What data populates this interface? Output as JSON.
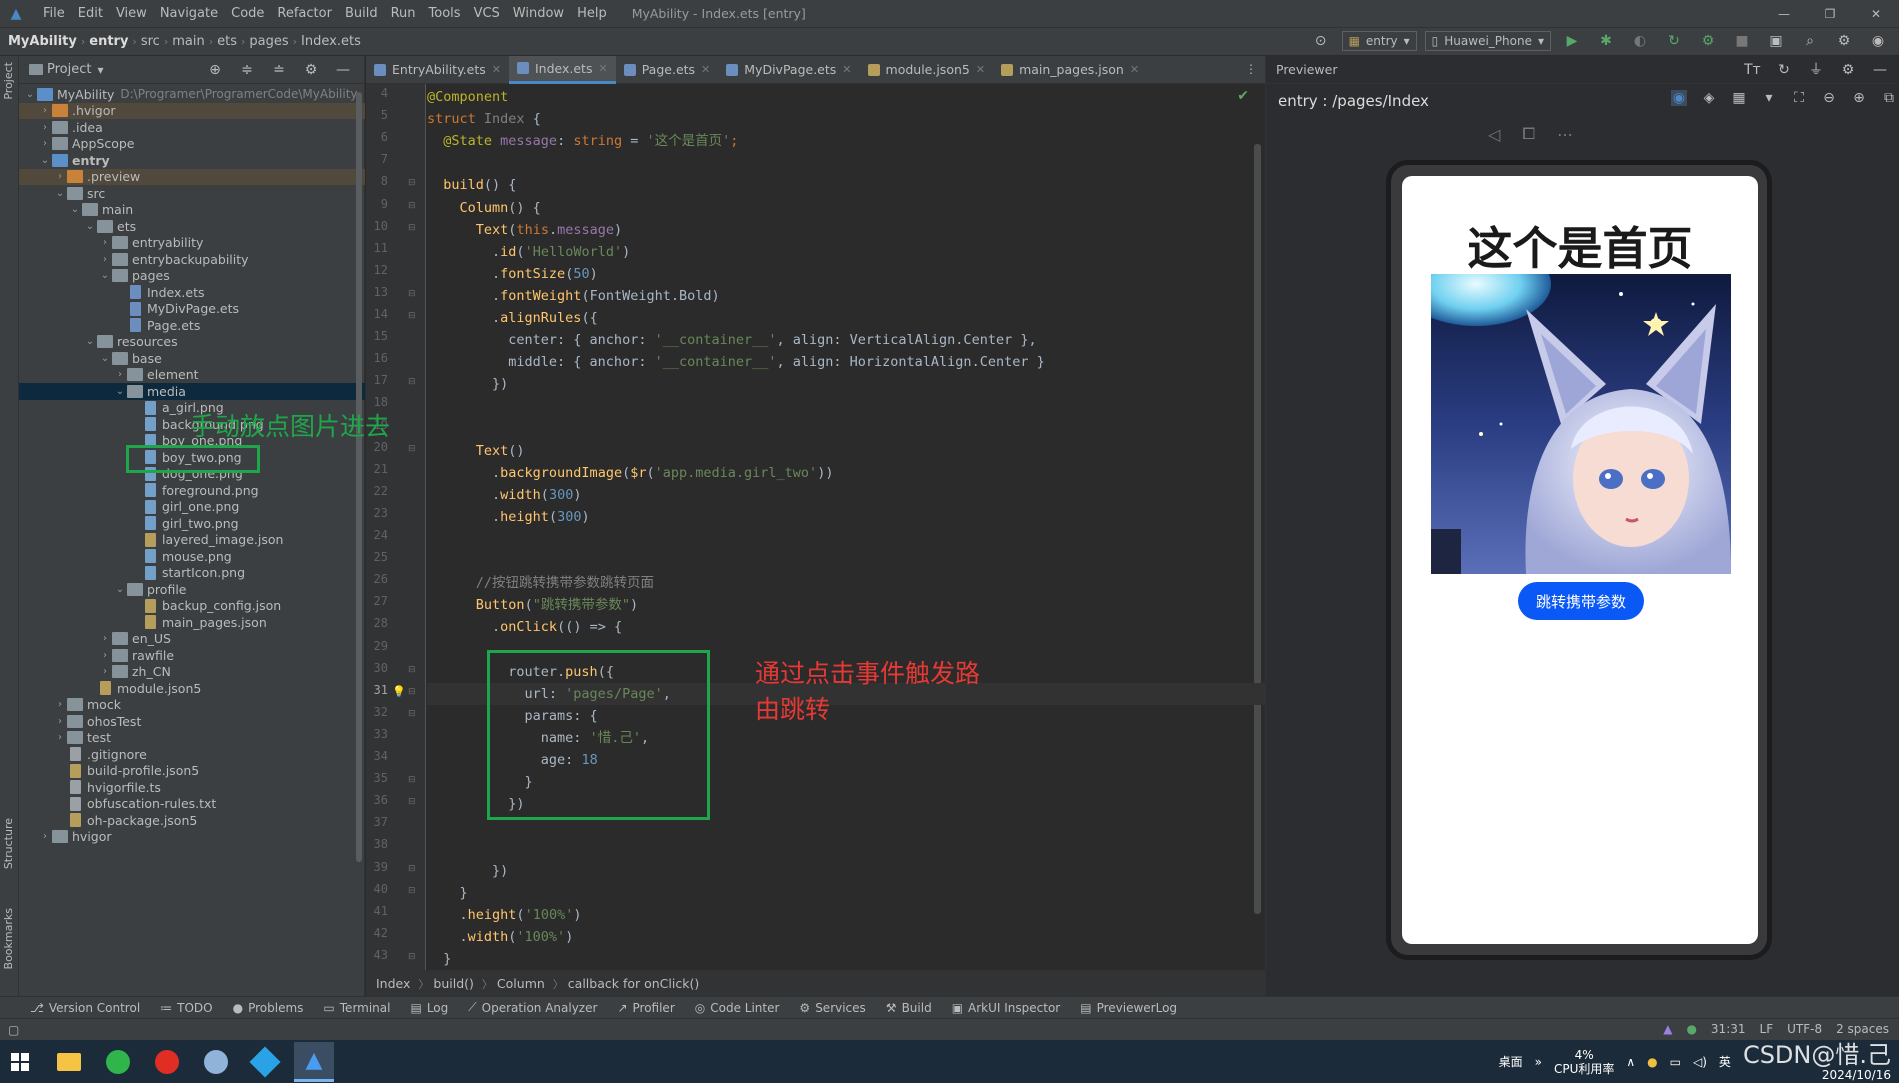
{
  "titlebar": {
    "menu": [
      "File",
      "Edit",
      "View",
      "Navigate",
      "Code",
      "Refactor",
      "Build",
      "Run",
      "Tools",
      "VCS",
      "Window",
      "Help"
    ],
    "title": "MyAbility - Index.ets [entry]"
  },
  "navbar": {
    "crumbs": [
      "MyAbility",
      "entry",
      "src",
      "main",
      "ets",
      "pages",
      "Index.ets"
    ],
    "run_config": "entry",
    "device": "Huawei_Phone"
  },
  "project_panel": {
    "title": "Project",
    "tree": [
      {
        "label": "MyAbility",
        "path": "D:\\Programer\\ProgramerCode\\MyAbility",
        "depth": 0,
        "type": "root",
        "open": true
      },
      {
        "label": ".hvigor",
        "depth": 1,
        "type": "folder-orange",
        "open": false,
        "excluded": true
      },
      {
        "label": ".idea",
        "depth": 1,
        "type": "folder",
        "open": false
      },
      {
        "label": "AppScope",
        "depth": 1,
        "type": "folder",
        "open": false
      },
      {
        "label": "entry",
        "depth": 1,
        "type": "folder-blue",
        "open": true,
        "bold": true
      },
      {
        "label": ".preview",
        "depth": 2,
        "type": "folder-orange",
        "open": false,
        "excluded": true
      },
      {
        "label": "src",
        "depth": 2,
        "type": "folder",
        "open": true
      },
      {
        "label": "main",
        "depth": 3,
        "type": "folder",
        "open": true
      },
      {
        "label": "ets",
        "depth": 4,
        "type": "folder",
        "open": true
      },
      {
        "label": "entryability",
        "depth": 5,
        "type": "folder",
        "open": false
      },
      {
        "label": "entrybackupability",
        "depth": 5,
        "type": "folder",
        "open": false
      },
      {
        "label": "pages",
        "depth": 5,
        "type": "folder",
        "open": true
      },
      {
        "label": "Index.ets",
        "depth": 6,
        "type": "ets"
      },
      {
        "label": "MyDivPage.ets",
        "depth": 6,
        "type": "ets"
      },
      {
        "label": "Page.ets",
        "depth": 6,
        "type": "ets"
      },
      {
        "label": "resources",
        "depth": 4,
        "type": "folder",
        "open": true
      },
      {
        "label": "base",
        "depth": 5,
        "type": "folder",
        "open": true
      },
      {
        "label": "element",
        "depth": 6,
        "type": "folder",
        "open": false
      },
      {
        "label": "media",
        "depth": 6,
        "type": "folder",
        "open": true,
        "selected": true
      },
      {
        "label": "a_girl.png",
        "depth": 7,
        "type": "png"
      },
      {
        "label": "background.png",
        "depth": 7,
        "type": "png"
      },
      {
        "label": "boy_one.png",
        "depth": 7,
        "type": "png"
      },
      {
        "label": "boy_two.png",
        "depth": 7,
        "type": "png"
      },
      {
        "label": "dog_one.png",
        "depth": 7,
        "type": "png"
      },
      {
        "label": "foreground.png",
        "depth": 7,
        "type": "png"
      },
      {
        "label": "girl_one.png",
        "depth": 7,
        "type": "png"
      },
      {
        "label": "girl_two.png",
        "depth": 7,
        "type": "png"
      },
      {
        "label": "layered_image.json",
        "depth": 7,
        "type": "json"
      },
      {
        "label": "mouse.png",
        "depth": 7,
        "type": "png"
      },
      {
        "label": "startIcon.png",
        "depth": 7,
        "type": "png"
      },
      {
        "label": "profile",
        "depth": 6,
        "type": "folder",
        "open": true
      },
      {
        "label": "backup_config.json",
        "depth": 7,
        "type": "json"
      },
      {
        "label": "main_pages.json",
        "depth": 7,
        "type": "json"
      },
      {
        "label": "en_US",
        "depth": 5,
        "type": "folder",
        "open": false
      },
      {
        "label": "rawfile",
        "depth": 5,
        "type": "folder",
        "open": false
      },
      {
        "label": "zh_CN",
        "depth": 5,
        "type": "folder",
        "open": false
      },
      {
        "label": "module.json5",
        "depth": 4,
        "type": "json"
      },
      {
        "label": "mock",
        "depth": 2,
        "type": "folder",
        "open": false
      },
      {
        "label": "ohosTest",
        "depth": 2,
        "type": "folder",
        "open": false
      },
      {
        "label": "test",
        "depth": 2,
        "type": "folder",
        "open": false
      },
      {
        "label": ".gitignore",
        "depth": 2,
        "type": "txt"
      },
      {
        "label": "build-profile.json5",
        "depth": 2,
        "type": "json"
      },
      {
        "label": "hvigorfile.ts",
        "depth": 2,
        "type": "txt"
      },
      {
        "label": "obfuscation-rules.txt",
        "depth": 2,
        "type": "txt"
      },
      {
        "label": "oh-package.json5",
        "depth": 2,
        "type": "json"
      },
      {
        "label": "hvigor",
        "depth": 1,
        "type": "folder",
        "open": false
      }
    ]
  },
  "editor": {
    "tabs": [
      {
        "label": "EntryAbility.ets",
        "kind": "ets",
        "active": false
      },
      {
        "label": "Index.ets",
        "kind": "ets",
        "active": true
      },
      {
        "label": "Page.ets",
        "kind": "ets",
        "active": false
      },
      {
        "label": "MyDivPage.ets",
        "kind": "ets",
        "active": false
      },
      {
        "label": "module.json5",
        "kind": "json",
        "active": false
      },
      {
        "label": "main_pages.json",
        "kind": "json",
        "active": false
      }
    ],
    "current_line": "31",
    "lines": [
      {
        "n": "4",
        "parts": [
          [
            "a",
            "@Component"
          ]
        ]
      },
      {
        "n": "5",
        "parts": [
          [
            "k",
            "struct "
          ],
          [
            "c",
            "Index "
          ],
          [
            "d",
            "{"
          ]
        ]
      },
      {
        "n": "6",
        "parts": [
          [
            "a",
            "  @State "
          ],
          [
            "p",
            "message"
          ],
          [
            "d",
            ": "
          ],
          [
            "k",
            "string "
          ],
          [
            "d",
            "= "
          ],
          [
            "s",
            "'这个是首页'"
          ],
          [
            "k",
            ";"
          ]
        ]
      },
      {
        "n": "7",
        "parts": []
      },
      {
        "n": "8",
        "parts": [
          [
            "f",
            "  build"
          ],
          [
            "d",
            "() {"
          ]
        ]
      },
      {
        "n": "9",
        "parts": [
          [
            "d",
            "    "
          ],
          [
            "f",
            "Column"
          ],
          [
            "d",
            "() {"
          ]
        ]
      },
      {
        "n": "10",
        "parts": [
          [
            "d",
            "      "
          ],
          [
            "f",
            "Text"
          ],
          [
            "d",
            "("
          ],
          [
            "k",
            "this"
          ],
          [
            "d",
            "."
          ],
          [
            "p",
            "message"
          ],
          [
            "d",
            ")"
          ]
        ]
      },
      {
        "n": "11",
        "parts": [
          [
            "d",
            "        ."
          ],
          [
            "f",
            "id"
          ],
          [
            "d",
            "("
          ],
          [
            "s",
            "'HelloWorld'"
          ],
          [
            "d",
            ")"
          ]
        ]
      },
      {
        "n": "12",
        "parts": [
          [
            "d",
            "        ."
          ],
          [
            "f",
            "fontSize"
          ],
          [
            "d",
            "("
          ],
          [
            "n",
            "50"
          ],
          [
            "d",
            ")"
          ]
        ]
      },
      {
        "n": "13",
        "parts": [
          [
            "d",
            "        ."
          ],
          [
            "f",
            "fontWeight"
          ],
          [
            "d",
            "(FontWeight.Bold)"
          ]
        ]
      },
      {
        "n": "14",
        "parts": [
          [
            "d",
            "        ."
          ],
          [
            "f",
            "alignRules"
          ],
          [
            "d",
            "({"
          ]
        ]
      },
      {
        "n": "15",
        "parts": [
          [
            "d",
            "          center: { anchor: "
          ],
          [
            "s",
            "'__container__'"
          ],
          [
            "d",
            ", align: VerticalAlign.Center },"
          ]
        ]
      },
      {
        "n": "16",
        "parts": [
          [
            "d",
            "          middle: { anchor: "
          ],
          [
            "s",
            "'__container__'"
          ],
          [
            "d",
            ", align: HorizontalAlign.Center }"
          ]
        ]
      },
      {
        "n": "17",
        "parts": [
          [
            "d",
            "        })"
          ]
        ]
      },
      {
        "n": "18",
        "parts": []
      },
      {
        "n": "19",
        "parts": []
      },
      {
        "n": "20",
        "parts": [
          [
            "d",
            "      "
          ],
          [
            "f",
            "Text"
          ],
          [
            "d",
            "()"
          ]
        ]
      },
      {
        "n": "21",
        "parts": [
          [
            "d",
            "        ."
          ],
          [
            "f",
            "backgroundImage"
          ],
          [
            "d",
            "("
          ],
          [
            "f",
            "$r"
          ],
          [
            "d",
            "("
          ],
          [
            "s",
            "'app.media.girl_two'"
          ],
          [
            "d",
            "))"
          ]
        ]
      },
      {
        "n": "22",
        "parts": [
          [
            "d",
            "        ."
          ],
          [
            "f",
            "width"
          ],
          [
            "d",
            "("
          ],
          [
            "n",
            "300"
          ],
          [
            "d",
            ")"
          ]
        ]
      },
      {
        "n": "23",
        "parts": [
          [
            "d",
            "        ."
          ],
          [
            "f",
            "height"
          ],
          [
            "d",
            "("
          ],
          [
            "n",
            "300"
          ],
          [
            "d",
            ")"
          ]
        ]
      },
      {
        "n": "24",
        "parts": []
      },
      {
        "n": "25",
        "parts": []
      },
      {
        "n": "26",
        "parts": [
          [
            "c",
            "      //按钮跳转携带参数跳转页面"
          ]
        ]
      },
      {
        "n": "27",
        "parts": [
          [
            "d",
            "      "
          ],
          [
            "f",
            "Button"
          ],
          [
            "d",
            "("
          ],
          [
            "s",
            "\"跳转携带参数\""
          ],
          [
            "d",
            ")"
          ]
        ]
      },
      {
        "n": "28",
        "parts": [
          [
            "d",
            "        ."
          ],
          [
            "f",
            "onClick"
          ],
          [
            "d",
            "(() => {"
          ]
        ]
      },
      {
        "n": "29",
        "parts": []
      },
      {
        "n": "30",
        "parts": [
          [
            "d",
            "          router."
          ],
          [
            "f",
            "push"
          ],
          [
            "d",
            "({"
          ]
        ]
      },
      {
        "n": "31",
        "parts": [
          [
            "d",
            "            url: "
          ],
          [
            "s",
            "'pages/Page'"
          ],
          [
            "d",
            ","
          ]
        ]
      },
      {
        "n": "32",
        "parts": [
          [
            "d",
            "            params: {"
          ]
        ]
      },
      {
        "n": "33",
        "parts": [
          [
            "d",
            "              name: "
          ],
          [
            "s",
            "'惜.己'"
          ],
          [
            "d",
            ","
          ]
        ]
      },
      {
        "n": "34",
        "parts": [
          [
            "d",
            "              age: "
          ],
          [
            "n",
            "18"
          ]
        ]
      },
      {
        "n": "35",
        "parts": [
          [
            "d",
            "            }"
          ]
        ]
      },
      {
        "n": "36",
        "parts": [
          [
            "d",
            "          })"
          ]
        ]
      },
      {
        "n": "37",
        "parts": []
      },
      {
        "n": "38",
        "parts": []
      },
      {
        "n": "39",
        "parts": [
          [
            "d",
            "        })"
          ]
        ]
      },
      {
        "n": "40",
        "parts": [
          [
            "d",
            "    }"
          ]
        ]
      },
      {
        "n": "41",
        "parts": [
          [
            "d",
            "    ."
          ],
          [
            "f",
            "height"
          ],
          [
            "d",
            "("
          ],
          [
            "s",
            "'100%'"
          ],
          [
            "d",
            ")"
          ]
        ]
      },
      {
        "n": "42",
        "parts": [
          [
            "d",
            "    ."
          ],
          [
            "f",
            "width"
          ],
          [
            "d",
            "("
          ],
          [
            "s",
            "'100%'"
          ],
          [
            "d",
            ")"
          ]
        ]
      },
      {
        "n": "43",
        "parts": [
          [
            "d",
            "  }"
          ]
        ]
      }
    ],
    "breadcrumbs": [
      "Index",
      "build()",
      "Column",
      "callback for onClick()"
    ]
  },
  "previewer": {
    "title": "Previewer",
    "path": "entry : /pages/Index",
    "phone": {
      "title": "这个是首页",
      "button": "跳转携带参数"
    }
  },
  "annotations": {
    "media_note": "手动放点图片进去",
    "router_note_line1": "通过点击事件触发路",
    "router_note_line2": "由跳转",
    "color_box": "#1fa64a",
    "color_text_green": "#1fa64a",
    "color_text_red": "#e53935"
  },
  "tool_windows": [
    "Version Control",
    "TODO",
    "Problems",
    "Terminal",
    "Log",
    "Operation Analyzer",
    "Profiler",
    "Code Linter",
    "Services",
    "Build",
    "ArkUI Inspector",
    "PreviewerLog"
  ],
  "statusbar": {
    "position": "31:31",
    "line_sep": "LF",
    "encoding": "UTF-8",
    "indent": "2 spaces"
  },
  "side_tabs": {
    "left_top": "Project",
    "left_structure": "Structure",
    "left_bookmarks": "Bookmarks"
  },
  "taskbar": {
    "desktop": "桌面",
    "cpu_value": "4%",
    "cpu_label": "CPU利用率",
    "ime": "英",
    "date": "2024/10/16",
    "watermark": "CSDN@惜.己"
  },
  "colors": {
    "accent": "#4a88c7",
    "phone_button": "#0a59f7",
    "run_green": "#59a869"
  }
}
